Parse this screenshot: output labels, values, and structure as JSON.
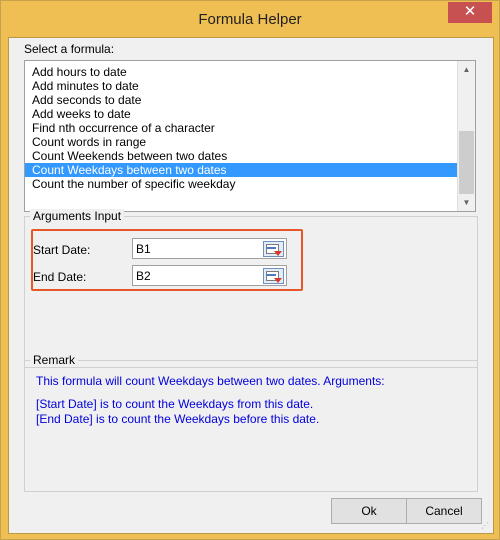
{
  "window": {
    "title": "Formula Helper",
    "close_glyph": "✕"
  },
  "formula_list": {
    "label": "Select a formula:",
    "items": [
      "Add hours to date",
      "Add minutes to date",
      "Add seconds to date",
      "Add weeks to date",
      "Find nth occurrence of a character",
      "Count words in range",
      "Count Weekends between two dates",
      "Count Weekdays between two dates",
      "Count the number of specific weekday"
    ],
    "selected_index": 7
  },
  "arguments": {
    "caption": "Arguments Input",
    "start_label": "Start Date:",
    "start_value": "B1",
    "end_label": "End Date:",
    "end_value": "B2",
    "highlight_color": "#e8572a"
  },
  "remark": {
    "caption": "Remark",
    "line1": "This formula will count Weekdays between two dates. Arguments:",
    "line2": "[Start Date] is to count the Weekdays from this date.",
    "line3": "[End Date] is to count the Weekdays before this date.",
    "text_color": "#0000dd"
  },
  "buttons": {
    "ok": "Ok",
    "cancel": "Cancel"
  },
  "colors": {
    "title_bar": "#f0bf54",
    "close_button": "#c75050",
    "selection": "#3399ff"
  }
}
